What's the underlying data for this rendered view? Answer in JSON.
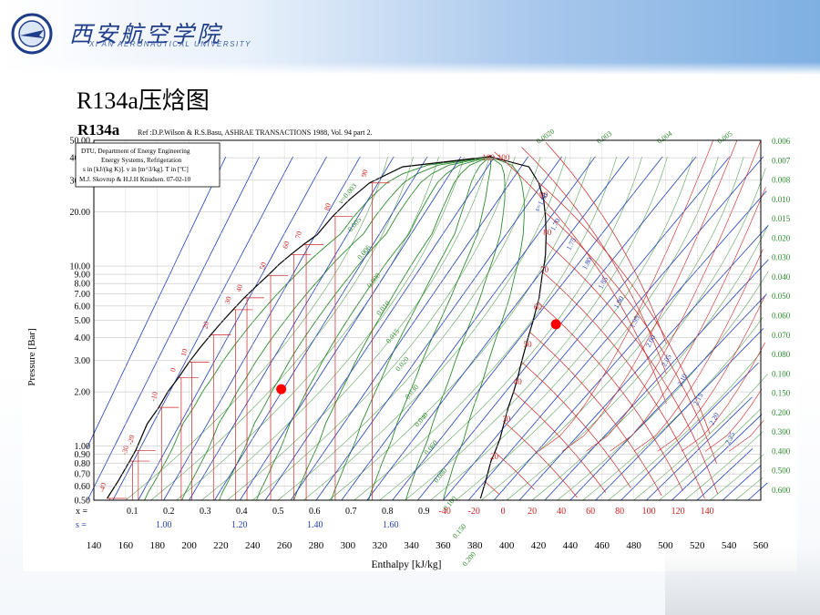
{
  "header": {
    "university_cn": "西安航空学院",
    "university_en": "XI'AN AERONAUTICAL UNIVERSITY",
    "logo_icon": "university-seal-icon"
  },
  "slide": {
    "title": "R134a压焓图"
  },
  "chart_data": {
    "type": "line",
    "title": "R134a",
    "reference": "Ref :D.P.Wilson & R.S.Basu, ASHRAE TRANSACTIONS 1988, Vol. 94 part 2.",
    "info_box": [
      "DTU, Department of Energy Engineering",
      "Energy Systems, Refrigeration",
      "s in [kJ/(kg K)]. v in [m^3/kg]. T in [ºC]",
      "M.J. Skovrup & H.J.H Knudsen. 07-02-10"
    ],
    "xlabel": "Enthalpy [kJ/kg]",
    "ylabel": "Pressure [Bar]",
    "xlim": [
      140,
      560
    ],
    "ylim": [
      0.5,
      50
    ],
    "y_scale": "log",
    "x_ticks": [
      "140",
      "160",
      "180",
      "200",
      "220",
      "240",
      "260",
      "280",
      "300",
      "320",
      "340",
      "360",
      "380",
      "400",
      "420",
      "440",
      "460",
      "480",
      "500",
      "520",
      "540",
      "560"
    ],
    "y_ticks": [
      "50.00",
      "40.00",
      "30.00",
      "20.00",
      "10.00",
      "9.00",
      "8.00",
      "7.00",
      "6.00",
      "5.00",
      "4.00",
      "3.00",
      "2.00",
      "1.00",
      "0.90",
      "0.80",
      "0.70",
      "0.60",
      "0.50"
    ],
    "quality_row_label": "x =",
    "quality_ticks": [
      "0.1",
      "0.2",
      "0.3",
      "0.4",
      "0.5",
      "0.6",
      "0.7",
      "0.8",
      "0.9"
    ],
    "entropy_row_label": "s =",
    "entropy_ticks": [
      "1.00",
      "1.20",
      "1.40",
      "1.60"
    ],
    "temperature_ticks_bottom": [
      "-40",
      "-20",
      "0",
      "20",
      "40",
      "60",
      "80",
      "100",
      "120",
      "140"
    ],
    "right_volume_ticks": [
      "0.006",
      "0.007",
      "0.008",
      "0.010",
      "0.015",
      "0.020",
      "0.030",
      "0.040",
      "0.050",
      "0.060",
      "0.070",
      "0.080",
      "0.100",
      "0.150",
      "0.200",
      "0.300",
      "0.400",
      "0.500",
      "0.600"
    ],
    "top_volume_labels": [
      "0.0020",
      "0.003",
      "0.004",
      "0.005"
    ],
    "liquid_isotherm_labels": [
      "-40",
      "-30",
      "-20",
      "-10",
      "0",
      "10",
      "20",
      "30",
      "40",
      "50",
      "60",
      "70",
      "80",
      "90"
    ],
    "vapor_isotherm_labels": [
      "100-100",
      "90",
      "80",
      "70",
      "60",
      "50",
      "40",
      "30",
      "20",
      "10",
      "0",
      "-10",
      "-20",
      "-30",
      "-40"
    ],
    "interior_volume_labels": [
      "v=0.003",
      "0.005",
      "0.006",
      "0.008",
      "0.010",
      "0.015",
      "0.020",
      "0.030",
      "0.040",
      "0.060",
      "0.080",
      "0.100",
      "0.150",
      "0.200"
    ],
    "entropy_line_labels": [
      "s=1.60",
      "1.70",
      "1.75",
      "1.80",
      "1.85",
      "1.90",
      "1.95",
      "2.00",
      "2.05",
      "2.10",
      "2.15",
      "2.20",
      "2.25"
    ],
    "critical_point": {
      "h": 389.6,
      "p": 40.6
    },
    "saturation_dome": {
      "liquid": [
        [
          148.4,
          0.512
        ],
        [
          155.4,
          0.64
        ],
        [
          162.6,
          0.825
        ],
        [
          166.3,
          0.943
        ],
        [
          173.6,
          1.33
        ],
        [
          180.9,
          1.64
        ],
        [
          186.7,
          2.01
        ],
        [
          193.3,
          2.4
        ],
        [
          200,
          2.93
        ],
        [
          206.7,
          3.5
        ],
        [
          213.6,
          4.15
        ],
        [
          220.5,
          4.88
        ],
        [
          227.6,
          5.72
        ],
        [
          234.7,
          6.66
        ],
        [
          242.0,
          7.7
        ],
        [
          249.6,
          8.87
        ],
        [
          256.4,
          10.17
        ],
        [
          264.1,
          11.6
        ],
        [
          272.0,
          13.18
        ],
        [
          280.5,
          14.91
        ],
        [
          290.3,
          18.87
        ],
        [
          301.2,
          23.5
        ],
        [
          313.6,
          29.0
        ],
        [
          334.4,
          35.6
        ],
        [
          389.6,
          40.6
        ]
      ],
      "vapor": [
        [
          389.6,
          40.6
        ],
        [
          414,
          35.6
        ],
        [
          420.1,
          29.0
        ],
        [
          423.2,
          23.5
        ],
        [
          424.4,
          18.87
        ],
        [
          424.8,
          14.91
        ],
        [
          424.4,
          11.6
        ],
        [
          423.6,
          10.17
        ],
        [
          422.3,
          8.87
        ],
        [
          420.4,
          6.66
        ],
        [
          418.4,
          5.72
        ],
        [
          416.4,
          4.88
        ],
        [
          414.0,
          4.15
        ],
        [
          411.7,
          3.5
        ],
        [
          409.3,
          2.93
        ],
        [
          406.9,
          2.4
        ],
        [
          404.4,
          2.01
        ],
        [
          401.0,
          1.64
        ],
        [
          398.2,
          1.33
        ],
        [
          395.8,
          1.1
        ],
        [
          392.9,
          0.943
        ],
        [
          390.1,
          0.825
        ],
        [
          386.8,
          0.64
        ],
        [
          383.5,
          0.512
        ]
      ]
    },
    "marked_points": [
      {
        "h": 258.0,
        "p": 2.07
      },
      {
        "h": 431.0,
        "p": 4.75
      }
    ],
    "colors": {
      "dome": "#000000",
      "isotherm": "#cc2222",
      "isentrope": "#1f3fb8",
      "isochore": "#2e8b2e",
      "quality": "#2e8b2e",
      "point": "#ff0000",
      "axis_text": "#000000",
      "entropy_text": "#1f3fb8"
    }
  }
}
